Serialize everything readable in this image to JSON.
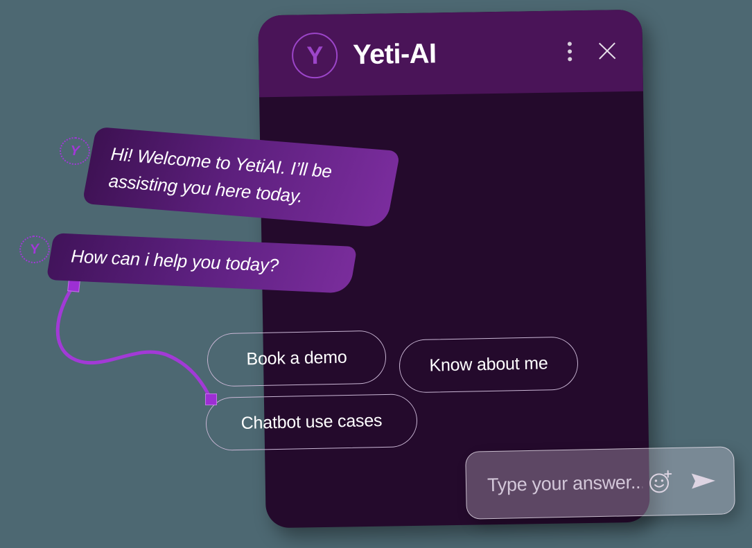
{
  "theme": {
    "page_background": "#4d6872",
    "window_background": "#240a2c",
    "header_background": "#4a1458",
    "accent_purple": "#9c45c9",
    "connector_purple": "#9d2fd4",
    "pill_border": "#cbb8d6",
    "bubble_gradient_from": "#3d1152",
    "bubble_gradient_to": "#7b2d9e",
    "text_white": "#ffffff",
    "placeholder_text": "#d3c7d9"
  },
  "header": {
    "logo_letter": "Y",
    "logo_icon": "yeti-logo-icon",
    "title": "Yeti-AI",
    "menu_icon": "kebab-menu-icon",
    "close_icon": "close-icon"
  },
  "messages": [
    {
      "id": "welcome",
      "sender": "bot",
      "avatar_letter": "Y",
      "text": "Hi! Welcome to YetiAI. I’ll be assisting you here today."
    },
    {
      "id": "prompt",
      "sender": "bot",
      "avatar_letter": "Y",
      "text": "How can i help you today?"
    }
  ],
  "quick_replies": [
    {
      "id": "book-a-demo",
      "label": "Book a demo"
    },
    {
      "id": "know-about-me",
      "label": "Know about me"
    },
    {
      "id": "chatbot-use-cases",
      "label": "Chatbot use cases"
    }
  ],
  "composer": {
    "placeholder": "Type your answer...",
    "value": "",
    "emoji_icon": "emoji-add-icon",
    "send_icon": "send-icon"
  }
}
